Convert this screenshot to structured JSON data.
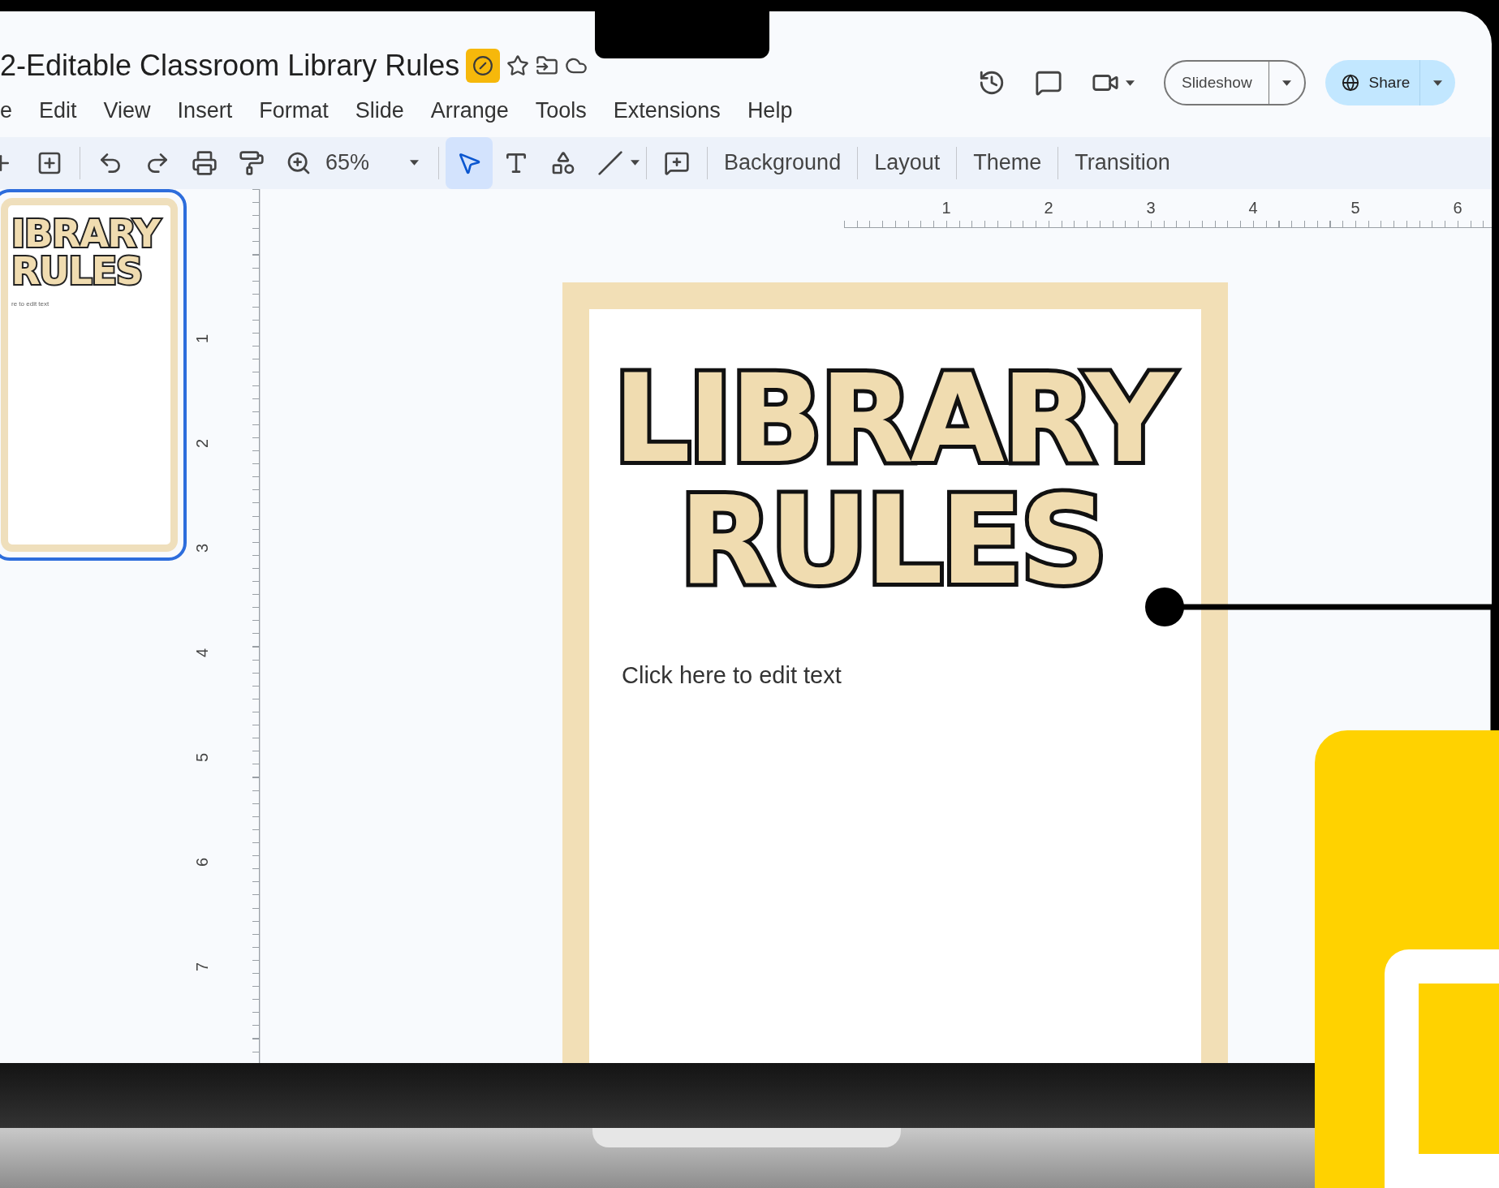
{
  "document": {
    "title": "2-Editable Classroom Library Rules"
  },
  "menu": [
    "e",
    "Edit",
    "View",
    "Insert",
    "Format",
    "Slide",
    "Arrange",
    "Tools",
    "Extensions",
    "Help"
  ],
  "header": {
    "slideshow": "Slideshow",
    "share": "Share"
  },
  "toolbar": {
    "zoom": "65%",
    "tools": [
      {
        "kind": "new-slide",
        "selected": false
      },
      {
        "kind": "undo",
        "selected": false
      },
      {
        "kind": "redo",
        "selected": false
      },
      {
        "kind": "print",
        "selected": false
      },
      {
        "kind": "paint-format",
        "selected": false
      },
      {
        "kind": "zoom",
        "selected": false
      }
    ],
    "draw_tools": [
      {
        "kind": "select",
        "selected": true
      },
      {
        "kind": "text",
        "selected": false
      },
      {
        "kind": "shape",
        "selected": false
      },
      {
        "kind": "line",
        "selected": false
      },
      {
        "kind": "comment",
        "selected": false
      }
    ],
    "actions": [
      "Background",
      "Layout",
      "Theme",
      "Transition"
    ]
  },
  "ruler": {
    "horizontal": [
      "1",
      "2",
      "3",
      "4",
      "5",
      "6"
    ],
    "vertical": [
      "1",
      "2",
      "3",
      "4",
      "5",
      "6",
      "7"
    ]
  },
  "thumbnail": {
    "selected": true,
    "title_lines": [
      "IBRARY",
      "RULES"
    ],
    "caption": "re to edit text"
  },
  "slide": {
    "title_lines": [
      "LIBRARY",
      "RULES"
    ],
    "body": "Click here to edit text"
  }
}
